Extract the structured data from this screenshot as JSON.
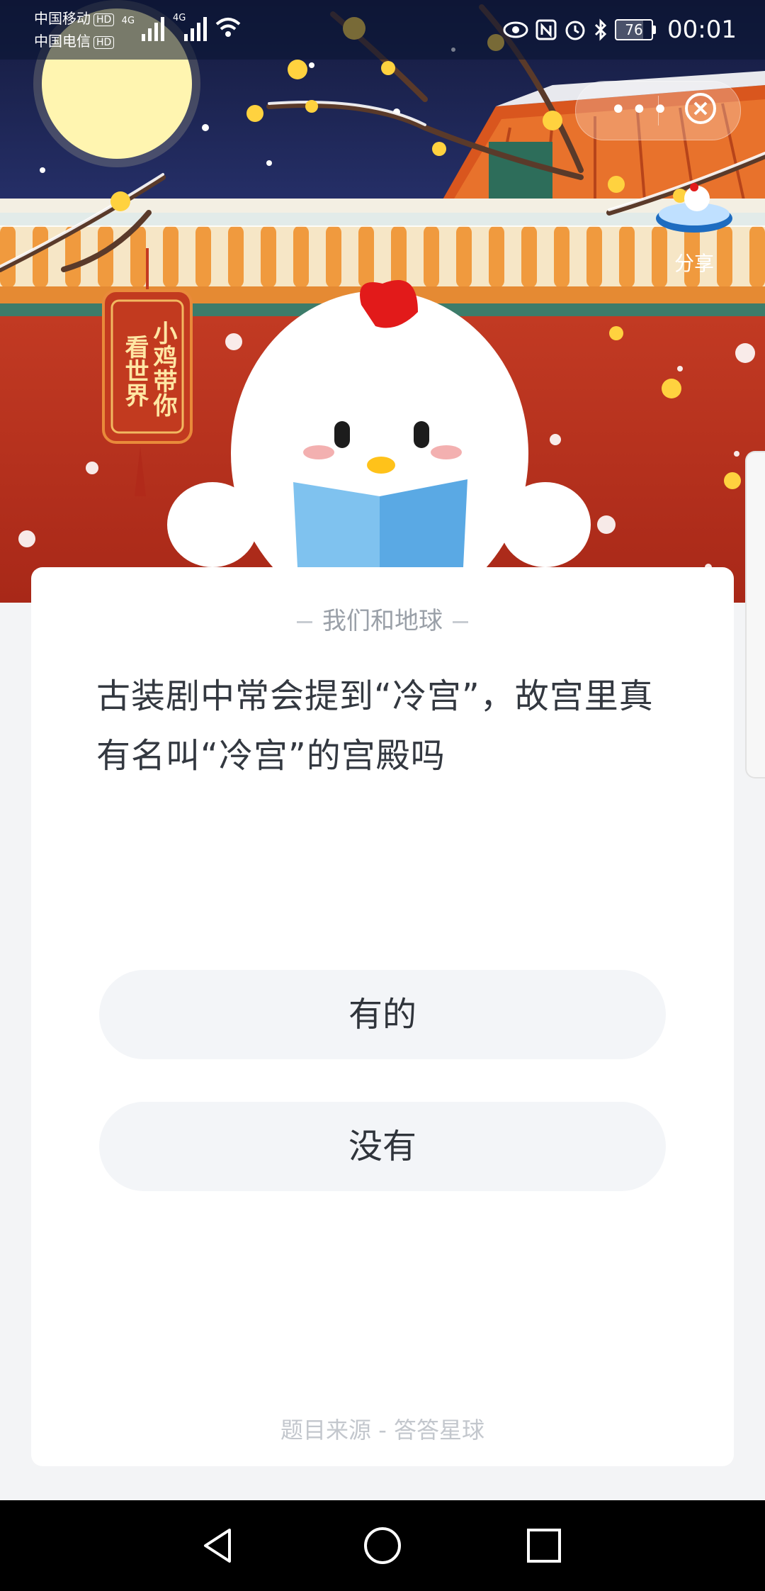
{
  "status_bar": {
    "carrier1": "中国移动",
    "carrier2": "中国电信",
    "hd": "HD",
    "net1": "4G",
    "net2": "4G",
    "battery": "76",
    "time": "00:01"
  },
  "header": {
    "menu_icon": "more-dots-icon",
    "close_icon": "close-circle-icon",
    "share_label": "分享",
    "tag_line1": "小鸡带你",
    "tag_line2": "看世界"
  },
  "quiz": {
    "topic": "我们和地球",
    "question": "古装剧中常会提到“冷宫”，故宫里真有名叫“冷宫”的宫殿吗",
    "options": [
      "有的",
      "没有"
    ],
    "source": "题目来源 - 答答星球"
  },
  "nav": {
    "back_icon": "back-triangle-icon",
    "home_icon": "home-circle-icon",
    "recent_icon": "recent-square-icon"
  },
  "colors": {
    "night_sky": "#1c2450",
    "palace_red": "#b8311f",
    "roof_orange": "#d9561e",
    "moon": "#fff6b0",
    "card": "#ffffff",
    "option_bg": "#f3f5f8"
  }
}
